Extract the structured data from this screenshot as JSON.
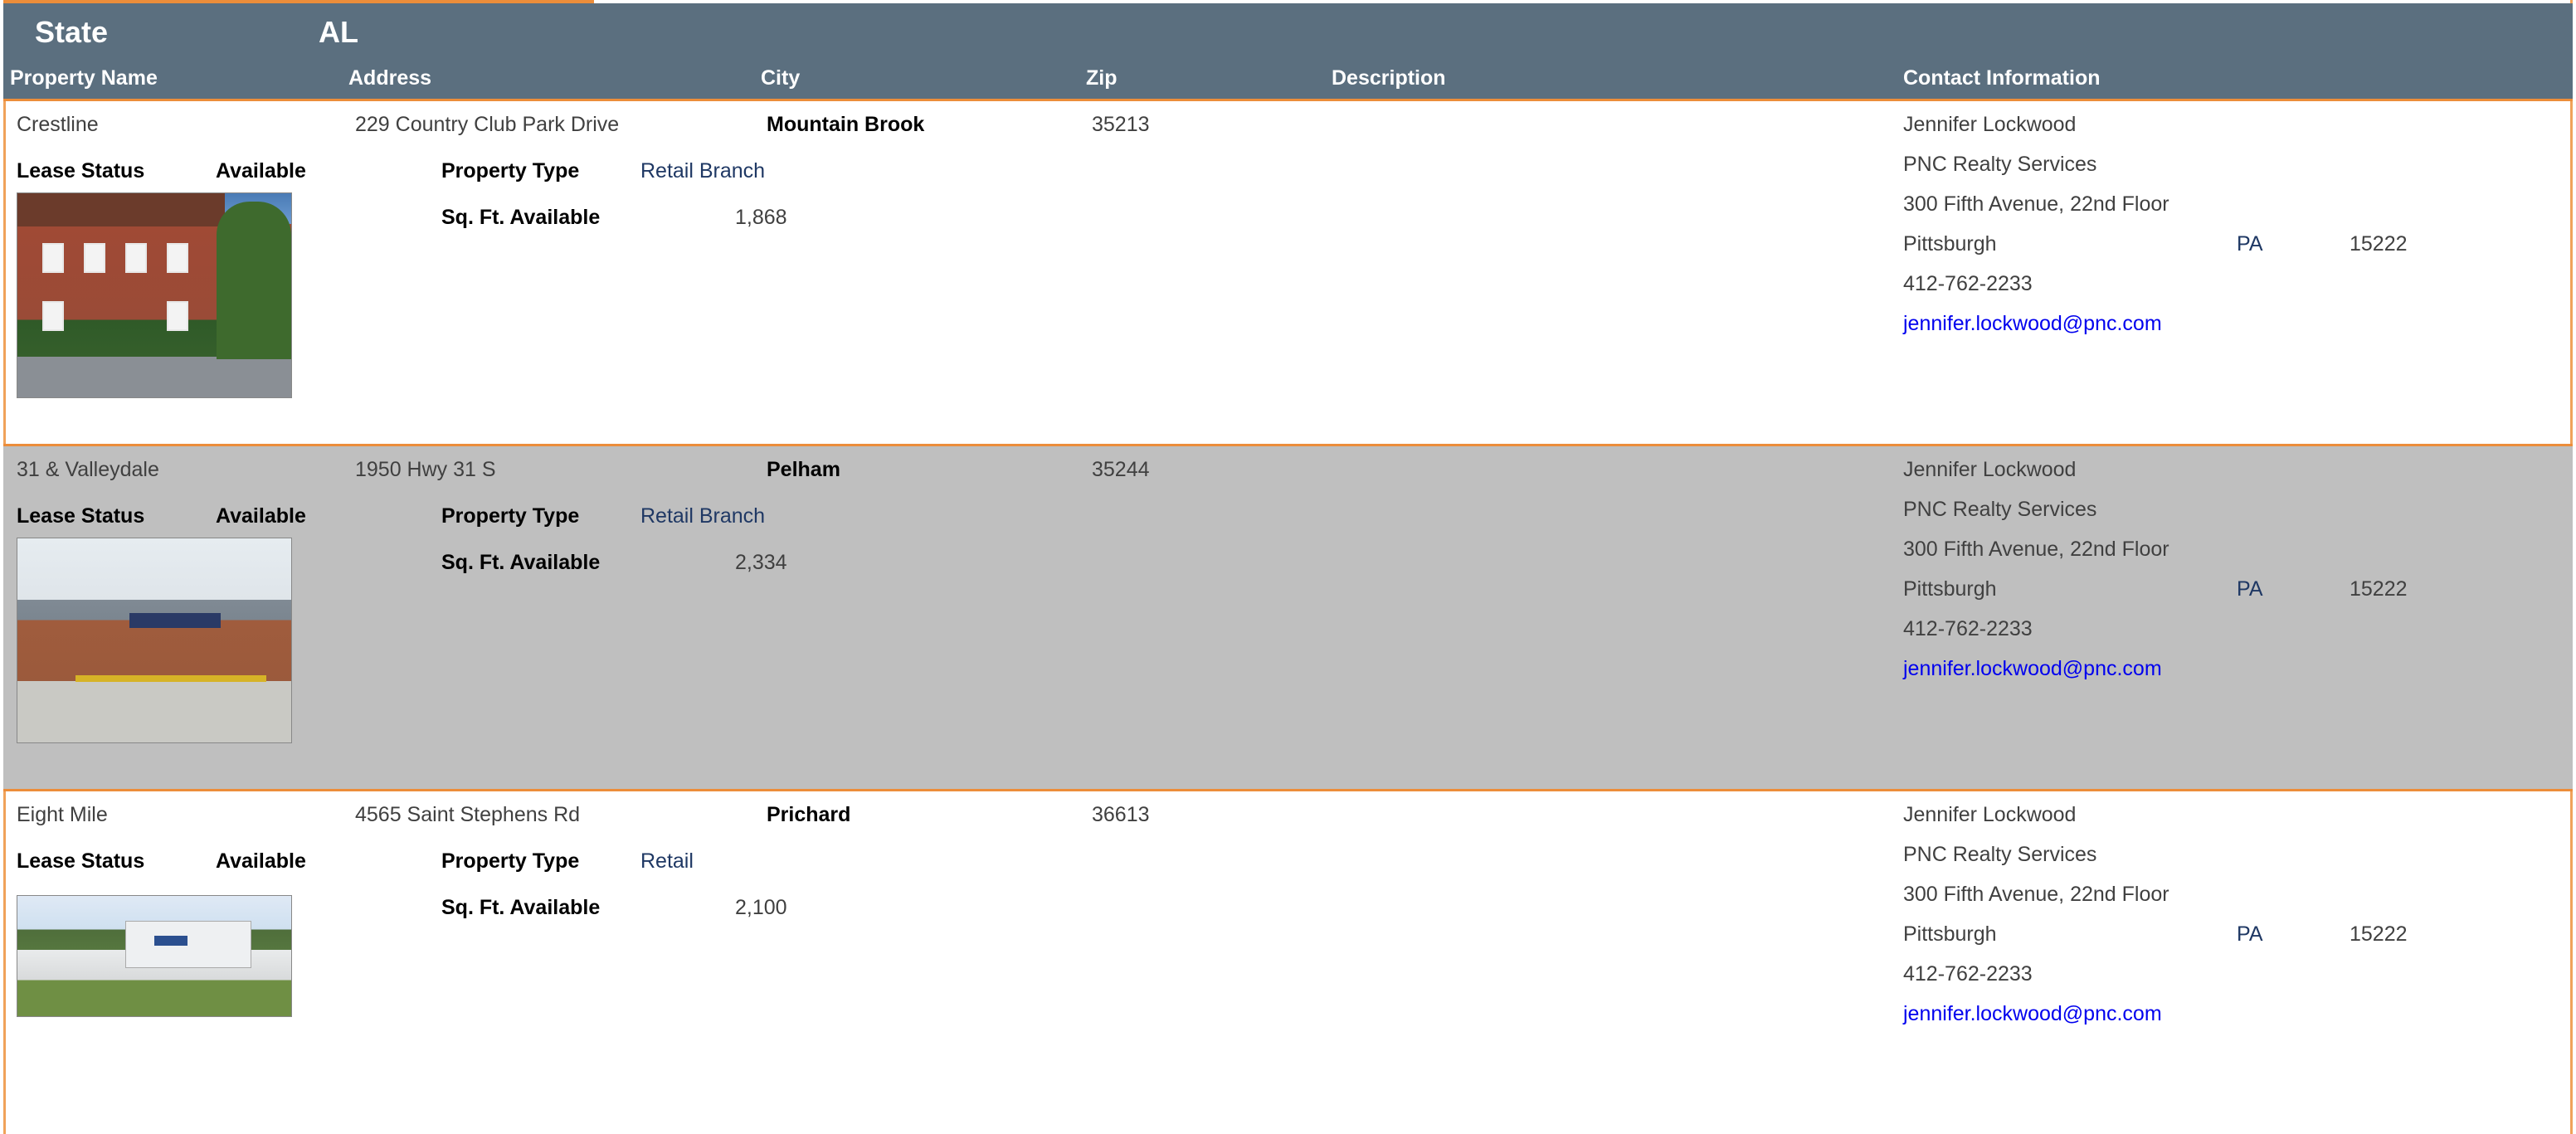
{
  "header": {
    "state_label": "State",
    "state_value": "AL",
    "columns": {
      "property_name": "Property Name",
      "address": "Address",
      "city": "City",
      "zip": "Zip",
      "description": "Description",
      "contact": "Contact Information"
    }
  },
  "labels": {
    "lease_status": "Lease Status",
    "property_type": "Property Type",
    "sqft": "Sq. Ft. Available"
  },
  "properties": [
    {
      "name": "Crestline",
      "address": "229 Country Club Park Drive",
      "city": "Mountain Brook",
      "zip": "35213",
      "lease_status": "Available",
      "property_type": "Retail Branch",
      "sqft": "1,868",
      "contact": {
        "name": "Jennifer Lockwood",
        "company": "PNC Realty Services",
        "street": "300 Fifth Avenue, 22nd Floor",
        "city": "Pittsburgh",
        "state": "PA",
        "zip": "15222",
        "phone": "412-762-2233",
        "email": "jennifer.lockwood@pnc.com"
      }
    },
    {
      "name": "31 & Valleydale",
      "address": "1950 Hwy 31 S",
      "city": "Pelham",
      "zip": "35244",
      "lease_status": "Available",
      "property_type": "Retail Branch",
      "sqft": "2,334",
      "contact": {
        "name": "Jennifer Lockwood",
        "company": "PNC Realty Services",
        "street": "300 Fifth Avenue, 22nd Floor",
        "city": "Pittsburgh",
        "state": "PA",
        "zip": "15222",
        "phone": "412-762-2233",
        "email": "jennifer.lockwood@pnc.com"
      }
    },
    {
      "name": "Eight Mile",
      "address": "4565 Saint Stephens Rd",
      "city": "Prichard",
      "zip": "36613",
      "lease_status": "Available",
      "property_type": "Retail",
      "sqft": "2,100",
      "contact": {
        "name": "Jennifer Lockwood",
        "company": "PNC Realty Services",
        "street": "300 Fifth Avenue, 22nd Floor",
        "city": "Pittsburgh",
        "state": "PA",
        "zip": "15222",
        "phone": "412-762-2233",
        "email": "jennifer.lockwood@pnc.com"
      }
    }
  ],
  "colors": {
    "header_bg": "#5b6f7f",
    "accent_border": "#ec8d3a",
    "alt_row_bg": "#bfbfbf",
    "link": "#0000ee"
  }
}
